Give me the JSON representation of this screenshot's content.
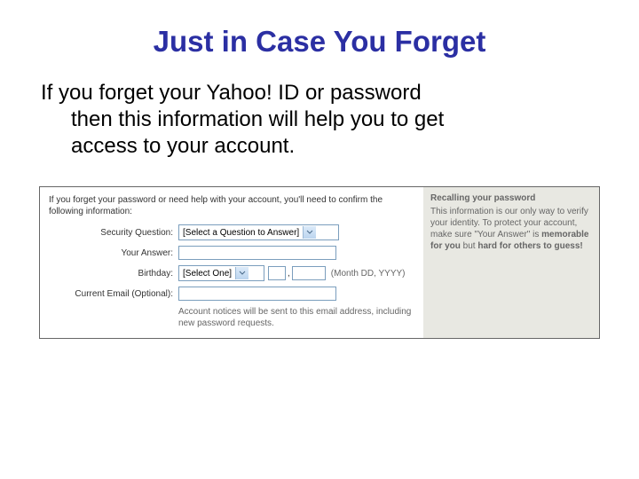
{
  "title": "Just in Case You Forget",
  "body_line1": "If you forget your Yahoo! ID or password",
  "body_line2": "then this information will help you to get",
  "body_line3": "access to your account.",
  "form": {
    "instruction": "If you forget your password or need help with your account, you'll need to confirm the following information:",
    "labels": {
      "security_question": "Security Question:",
      "your_answer": "Your Answer:",
      "birthday": "Birthday:",
      "current_email": "Current Email (Optional):"
    },
    "security_question_selected": "[Select a Question to Answer]",
    "answer_value": "",
    "birthday_month_selected": "[Select One]",
    "birthday_day_value": "",
    "birthday_year_value": "",
    "birthday_hint": "(Month DD, YYYY)",
    "email_value": "",
    "email_note": "Account notices will be sent to this email address, including new password requests."
  },
  "aside": {
    "title": "Recalling your password",
    "text_1": "This information is our only way to verify your identity. To protect your account, make sure \"Your Answer\" is ",
    "bold_1": "memorable for you",
    "text_2": " but ",
    "bold_2": "hard for others to guess!"
  },
  "comma": ","
}
